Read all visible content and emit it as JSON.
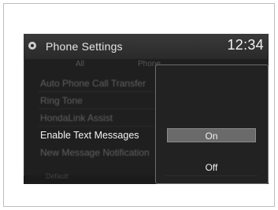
{
  "header": {
    "title": "Phone Settings",
    "time": "12:34",
    "icon": "settings-icon"
  },
  "tabs": [
    "All",
    "Phone"
  ],
  "list": {
    "items": [
      "Auto Phone Call Transfer",
      "Ring Tone",
      "HondaLink Assist",
      "Enable Text Messages",
      "New Message Notification"
    ],
    "active_index": 3
  },
  "bottom": {
    "button_label": "Default"
  },
  "popup": {
    "options": [
      "On",
      "Off"
    ],
    "selected": "On"
  },
  "colors": {
    "screen_bg": "#1f1f1f",
    "highlight": "#6a6a6a",
    "text": "#f0f0f0"
  }
}
